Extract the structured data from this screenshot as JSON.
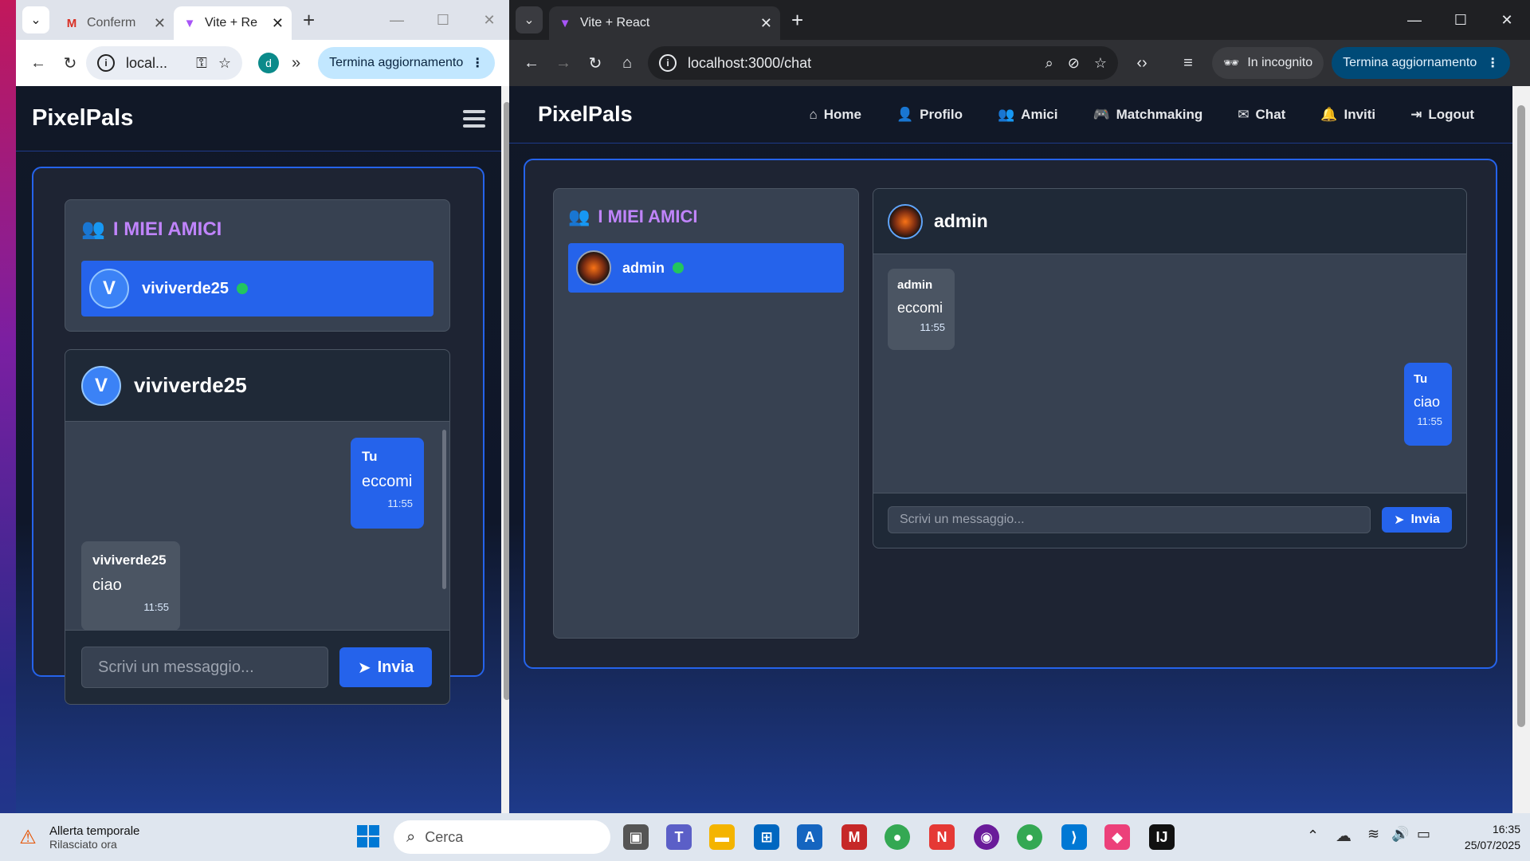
{
  "left_window": {
    "tabs": [
      {
        "label": "Conferm",
        "favicon": "gmail-icon"
      },
      {
        "label": "Vite + Re",
        "favicon": "vite-icon"
      }
    ],
    "address": "local...",
    "profile_initial": "d",
    "update_button": "Termina aggiornamento",
    "app": {
      "brand": "PixelPals",
      "friends_title": "I MIEI AMICI",
      "friend_name": "viviverde25",
      "friend_initial": "V",
      "chat_with": "viviverde25",
      "messages": [
        {
          "from": "Tu",
          "text": "eccomi",
          "time": "11:55"
        },
        {
          "from": "viviverde25",
          "text": "ciao",
          "time": "11:55"
        }
      ],
      "input_placeholder": "Scrivi un messaggio...",
      "send_label": "Invia"
    }
  },
  "right_window": {
    "tabs": [
      {
        "label": "Vite + React",
        "favicon": "vite-icon"
      }
    ],
    "address": "localhost:3000/chat",
    "incognito_label": "In incognito",
    "update_button": "Termina aggiornamento",
    "app": {
      "brand": "PixelPals",
      "nav": [
        {
          "label": "Home",
          "icon": "home-icon"
        },
        {
          "label": "Profilo",
          "icon": "user-icon"
        },
        {
          "label": "Amici",
          "icon": "users-icon"
        },
        {
          "label": "Matchmaking",
          "icon": "gamepad-icon"
        },
        {
          "label": "Chat",
          "icon": "envelope-icon"
        },
        {
          "label": "Inviti",
          "icon": "bell-icon"
        },
        {
          "label": "Logout",
          "icon": "logout-icon"
        }
      ],
      "friends_title": "I MIEI AMICI",
      "friend_name": "admin",
      "chat_with": "admin",
      "messages": [
        {
          "from": "admin",
          "text": "eccomi",
          "time": "11:55"
        },
        {
          "from": "Tu",
          "text": "ciao",
          "time": "11:55"
        }
      ],
      "input_placeholder": "Scrivi un messaggio...",
      "send_label": "Invia"
    }
  },
  "taskbar": {
    "alert_title": "Allerta temporale",
    "alert_sub": "Rilasciato ora",
    "search_placeholder": "Cerca",
    "time": "16:35",
    "date": "25/07/2025"
  },
  "colors": {
    "accent": "#2563eb",
    "friends_title": "#c084fc",
    "online": "#22c55e"
  }
}
